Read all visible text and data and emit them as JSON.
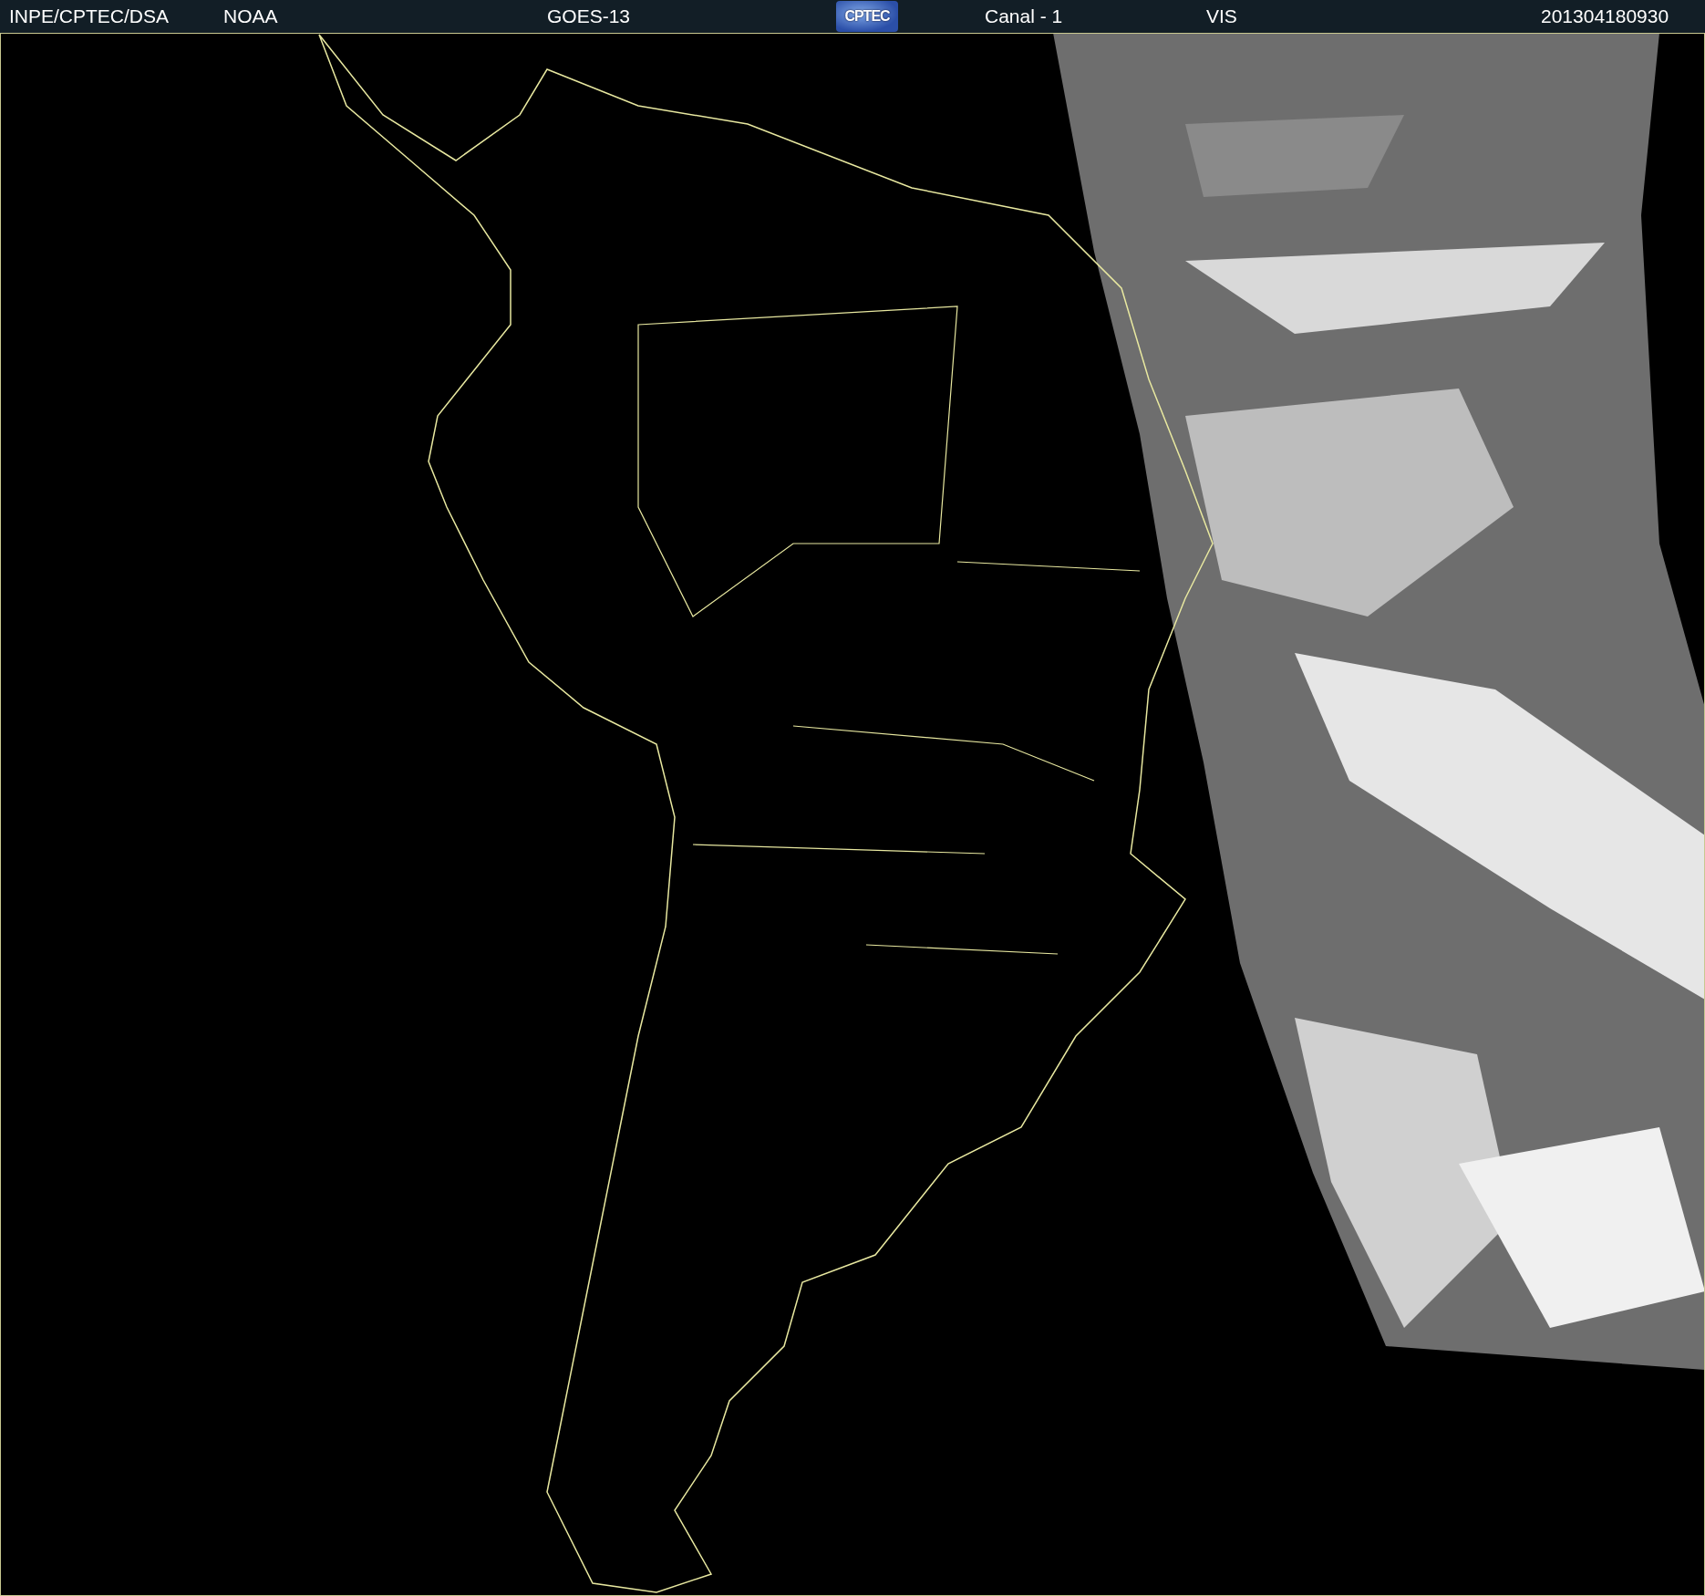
{
  "header": {
    "items": [
      {
        "kind": "text",
        "text": "INPE/CPTEC/DSA"
      },
      {
        "kind": "text",
        "text": "NOAA"
      },
      {
        "kind": "text",
        "text": "GOES-13"
      },
      {
        "kind": "logo",
        "text": "CPTEC"
      },
      {
        "kind": "text",
        "text": "Canal - 1"
      },
      {
        "kind": "text",
        "text": "VIS"
      },
      {
        "kind": "text",
        "text": "201304180930"
      }
    ]
  }
}
